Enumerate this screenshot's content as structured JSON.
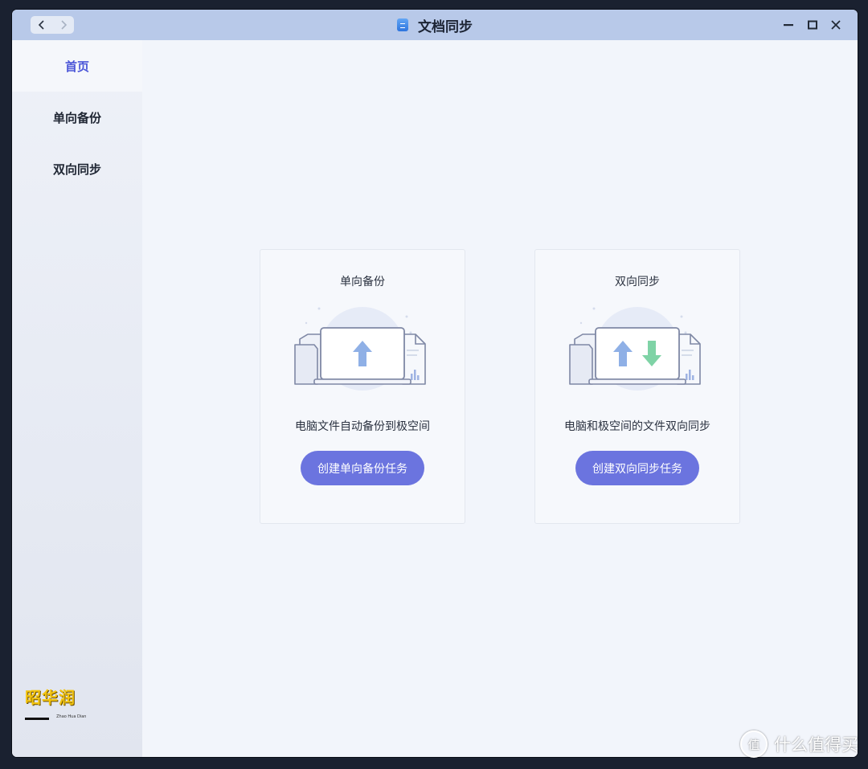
{
  "window": {
    "title": "文档同步",
    "icon": "app-icon"
  },
  "sidebar": {
    "items": [
      {
        "label": "首页",
        "active": true
      },
      {
        "label": "单向备份",
        "active": false
      },
      {
        "label": "双向同步",
        "active": false
      }
    ],
    "logo_text": "昭华润",
    "logo_sub": "Zhao Hua Dian"
  },
  "cards": [
    {
      "title": "单向备份",
      "illustration": "laptop-upload-icon",
      "description": "电脑文件自动备份到极空间",
      "button_label": "创建单向备份任务"
    },
    {
      "title": "双向同步",
      "illustration": "laptop-sync-icon",
      "description": "电脑和极空间的文件双向同步",
      "button_label": "创建双向同步任务"
    }
  ],
  "watermark": {
    "symbol": "值",
    "text": "什么值得买"
  },
  "colors": {
    "accent": "#4b56d8",
    "button": "#6b74df",
    "titlebar": "#b8c9e9",
    "upload_arrow": "#8fb0e6",
    "download_arrow": "#7fd3a6"
  }
}
